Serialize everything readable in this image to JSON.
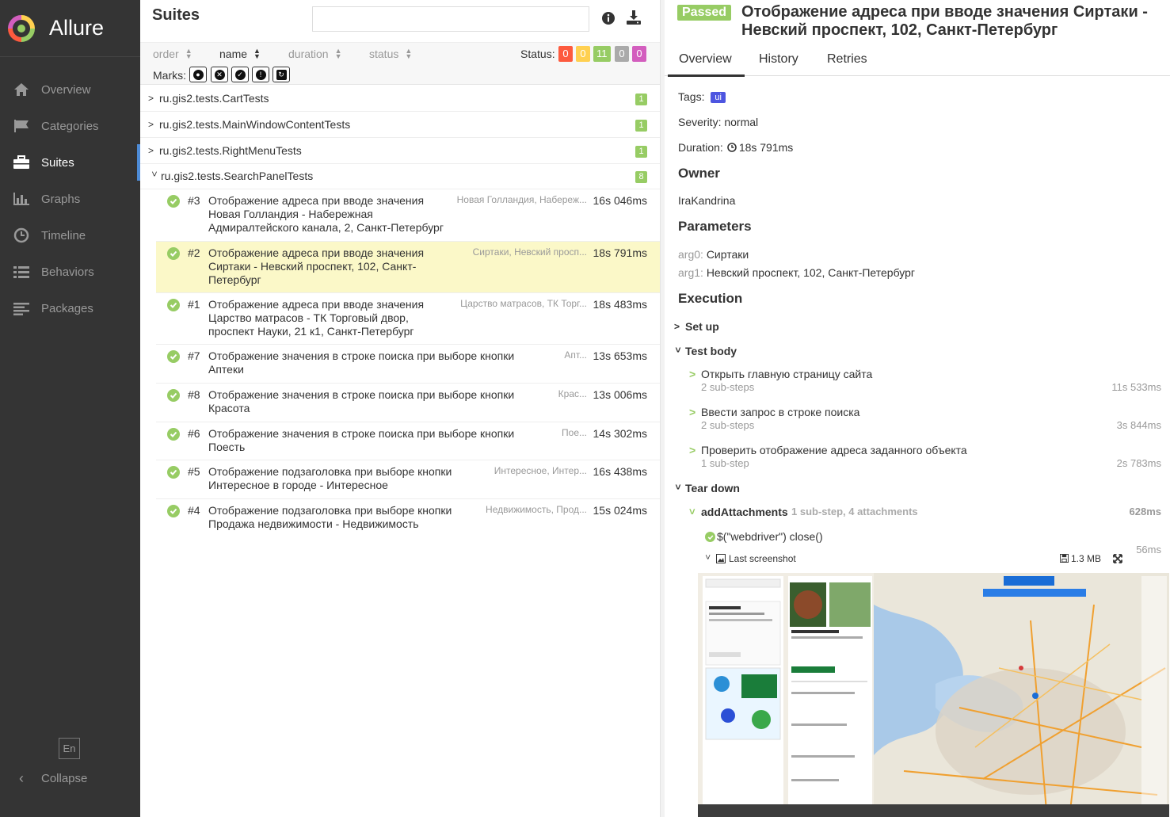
{
  "sidebar": {
    "brand": "Allure",
    "items": [
      {
        "label": "Overview",
        "icon": "home-icon"
      },
      {
        "label": "Categories",
        "icon": "flag-icon"
      },
      {
        "label": "Suites",
        "icon": "briefcase-icon",
        "active": true
      },
      {
        "label": "Graphs",
        "icon": "bar-chart-icon"
      },
      {
        "label": "Timeline",
        "icon": "clock-icon"
      },
      {
        "label": "Behaviors",
        "icon": "list-icon"
      },
      {
        "label": "Packages",
        "icon": "align-left-icon"
      }
    ],
    "lang": "En",
    "collapse": "Collapse"
  },
  "suites": {
    "title": "Suites",
    "search_value": "",
    "sort": [
      "order",
      "name",
      "duration",
      "status"
    ],
    "status_label": "Status:",
    "status_counts": [
      {
        "value": "0",
        "color": "#fd5a3e"
      },
      {
        "value": "0",
        "color": "#ffd050"
      },
      {
        "value": "11",
        "color": "#97cc64"
      },
      {
        "value": "0",
        "color": "#aaaaaa"
      },
      {
        "value": "0",
        "color": "#d35ebe"
      }
    ],
    "marks_label": "Marks:",
    "groups": [
      {
        "name": "ru.gis2.tests.CartTests",
        "count": "1",
        "expanded": false
      },
      {
        "name": "ru.gis2.tests.MainWindowContentTests",
        "count": "1",
        "expanded": false
      },
      {
        "name": "ru.gis2.tests.RightMenuTests",
        "count": "1",
        "expanded": false
      },
      {
        "name": "ru.gis2.tests.SearchPanelTests",
        "count": "8",
        "expanded": true
      }
    ],
    "tests": [
      {
        "num": "#3",
        "name": "Отображение адреса при вводе значения Новая Голландия - Набережная Адмиралтейского канала, 2, Санкт-Петербург",
        "params": "Новая Голландия, Набереж...",
        "duration": "16s 046ms"
      },
      {
        "num": "#2",
        "name": "Отображение адреса при вводе значения Сиртаки - Невский проспект, 102, Санкт-Петербург",
        "params": "Сиртаки, Невский просп...",
        "duration": "18s 791ms",
        "selected": true
      },
      {
        "num": "#1",
        "name": "Отображение адреса при вводе значения Царство матрасов - ТК Торговый двор, проспект Науки, 21 к1, Санкт-Петербург",
        "params": "Царство матрасов, ТК Торг...",
        "duration": "18s 483ms"
      },
      {
        "num": "#7",
        "name": "Отображение значения в строке поиска при выборе кнопки Аптеки",
        "params": "Апт...",
        "duration": "13s 653ms"
      },
      {
        "num": "#8",
        "name": "Отображение значения в строке поиска при выборе кнопки Красота",
        "params": "Крас...",
        "duration": "13s 006ms"
      },
      {
        "num": "#6",
        "name": "Отображение значения в строке поиска при выборе кнопки Поесть",
        "params": "Пое...",
        "duration": "14s 302ms"
      },
      {
        "num": "#5",
        "name": "Отображение подзаголовка при выборе кнопки Интересное в городе - Интересное",
        "params": "Интересное, Интер...",
        "duration": "16s 438ms"
      },
      {
        "num": "#4",
        "name": "Отображение подзаголовка при выборе кнопки Продажа недвижимости - Недвижимость",
        "params": "Недвижимость, Прод...",
        "duration": "15s 024ms"
      }
    ]
  },
  "detail": {
    "status": "Passed",
    "title": "Отображение адреса при вводе значения Сиртаки - Невский проспект, 102, Санкт-Петербург",
    "tabs": [
      "Overview",
      "History",
      "Retries"
    ],
    "tags_label": "Tags:",
    "tag": "ui",
    "severity": "Severity: normal",
    "duration_label": "Duration:",
    "duration": "18s 791ms",
    "owner_heading": "Owner",
    "owner": "IraKandrina",
    "params_heading": "Parameters",
    "params": [
      {
        "name": "arg0:",
        "value": "Сиртаки"
      },
      {
        "name": "arg1:",
        "value": "Невский проспект, 102, Санкт-Петербург"
      }
    ],
    "execution_heading": "Execution",
    "setup": "Set up",
    "testbody": "Test body",
    "steps": [
      {
        "name": "Открыть главную страницу сайта",
        "sub": "2 sub-steps",
        "duration": "11s 533ms"
      },
      {
        "name": "Ввести запрос в строке поиска",
        "sub": "2 sub-steps",
        "duration": "3s 844ms"
      },
      {
        "name": "Проверить отображение адреса заданного объекта",
        "sub": "1 sub-step",
        "duration": "2s 783ms"
      }
    ],
    "teardown": "Tear down",
    "attach_name": "addAttachments",
    "attach_meta": "1 sub-step, 4 attachments",
    "attach_duration": "628ms",
    "close_step": "$(\"webdriver\") close()",
    "close_duration": "56ms",
    "screenshot_label": "Last screenshot",
    "screenshot_size": "1.3 MB"
  }
}
